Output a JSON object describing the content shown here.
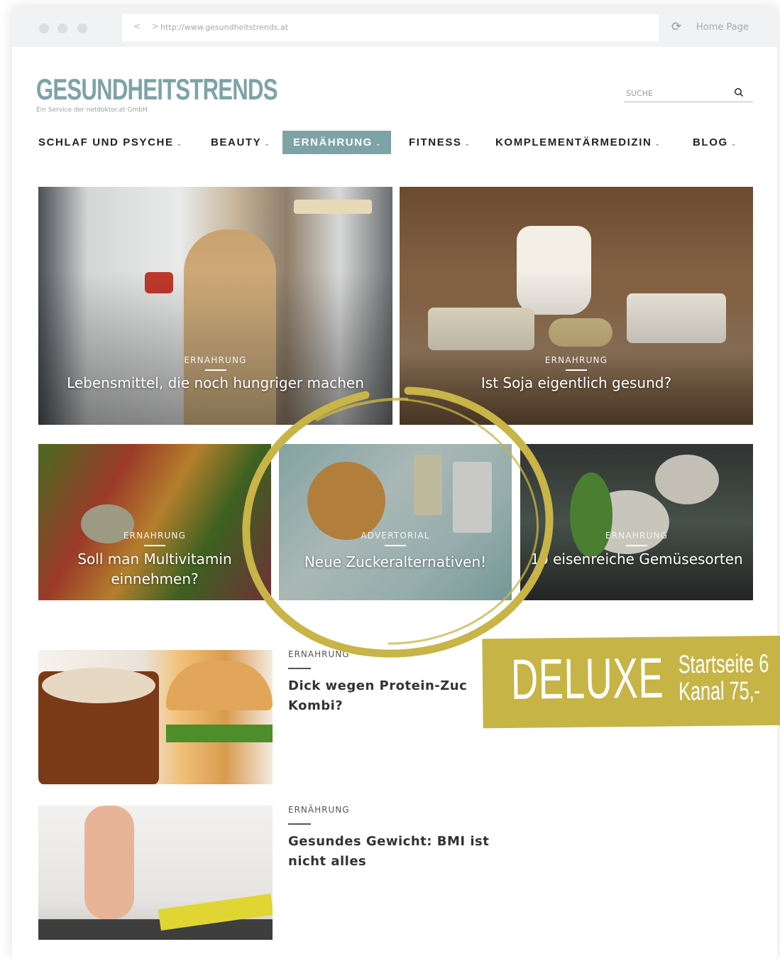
{
  "browser": {
    "url": "http://www.gesundheitstrends.at",
    "nav_arrows": "< >",
    "home_label": "Home Page",
    "reload_icon": "reload-icon"
  },
  "site": {
    "logo": "GESUNDHEITSTRENDS",
    "tagline": "Ein Service der netdoktor.at GmbH",
    "search_placeholder": "SUCHE"
  },
  "menu": [
    {
      "label": "SCHLAF UND PSYCHE",
      "active": false
    },
    {
      "label": "BEAUTY",
      "active": false
    },
    {
      "label": "ERNÄHRUNG",
      "active": true
    },
    {
      "label": "FITNESS",
      "active": false
    },
    {
      "label": "KOMPLEMENTÄRMEDIZIN",
      "active": false
    },
    {
      "label": "BLOG",
      "active": false
    }
  ],
  "featured": [
    {
      "category": "ERNAHRUNG",
      "title": "Lebensmittel, die noch hungriger machen"
    },
    {
      "category": "ERNAHRUNG",
      "title": "Ist Soja eigentlich gesund?"
    },
    {
      "category": "ERNAHRUNG",
      "title": "Soll man Multivitamin einnehmen?"
    },
    {
      "category": "ADVERTORIAL",
      "title": "Neue Zuckeralternativen!"
    },
    {
      "category": "ERNAHRUNG",
      "title": "10 eisenreiche Gemüsesorten"
    }
  ],
  "articles": [
    {
      "category": "ERNAHRUNG",
      "title": "Dick wegen Protein-Zuc Kombi?"
    },
    {
      "category": "ERNÄHRUNG",
      "title": "Gesundes Gewicht: BMI ist nicht alles"
    }
  ],
  "promo": {
    "title": "DELUXE",
    "line1": "Startseite 6",
    "line2": "Kanal 75,-",
    "color": "#c6b446"
  },
  "colors": {
    "accent": "#7ea3a7"
  }
}
